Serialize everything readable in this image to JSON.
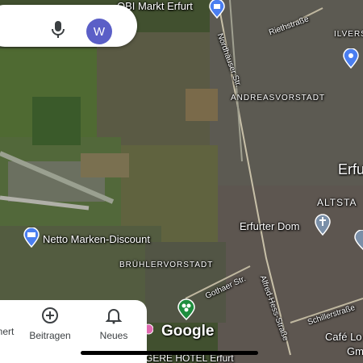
{
  "search": {
    "avatar_letter": "W"
  },
  "pois": {
    "obi": "OBI Markt Erfurt",
    "netto": "Netto Marken-Discount",
    "dom": "Erfurter Dom",
    "cafe_line1": "Café Lo",
    "cafe_line2": "Gm",
    "hotel": "GERE HOTEL Erfurt"
  },
  "districts": {
    "andreasvorstadt": "ANDREASVORSTADT",
    "altstadt": "ALTSTA",
    "bruehlervorstadt": "BRÜHLERVORSTADT",
    "ilversgehofen": "ILVERS"
  },
  "streets": {
    "nordhaeuser": "Nordhäuser Str.",
    "riethstrasse": "Riethstraße",
    "gothaer": "Gothaer Str.",
    "alfred_hess": "Alfred-Hess-Straße",
    "schiller": "Schillerstraße"
  },
  "city": {
    "erfurt_partial": "Erfu"
  },
  "attribution": {
    "google": "Google"
  },
  "nav": {
    "item_left": "nert",
    "item_contribute": "Beitragen",
    "item_news": "Neues"
  },
  "colors": {
    "accent_blue": "#4a7ef0",
    "avatar_bg": "#5b5fc7",
    "park_green": "#1e8e3e"
  }
}
